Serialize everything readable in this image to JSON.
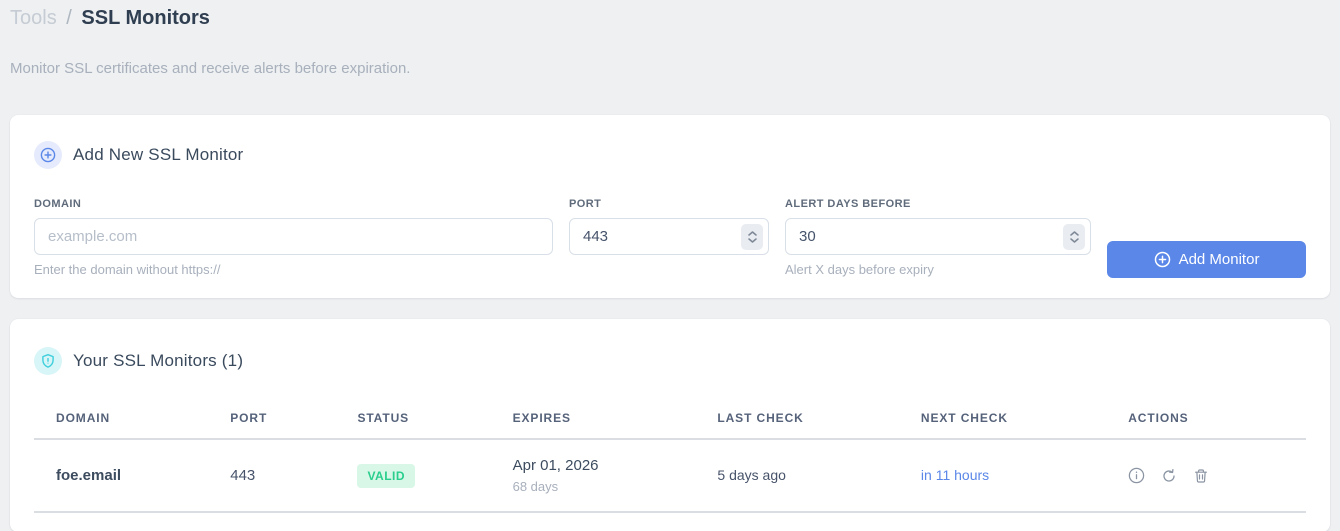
{
  "breadcrumb": {
    "section": "Tools",
    "separator": "/",
    "current": "SSL Monitors"
  },
  "subtitle": "Monitor SSL certificates and receive alerts before expiration.",
  "add_form": {
    "title": "Add New SSL Monitor",
    "fields": {
      "domain": {
        "label": "DOMAIN",
        "placeholder": "example.com",
        "helper": "Enter the domain without https://"
      },
      "port": {
        "label": "PORT",
        "value": "443"
      },
      "alert_days": {
        "label": "ALERT DAYS BEFORE",
        "value": "30",
        "helper": "Alert X days before expiry"
      }
    },
    "submit_label": "Add Monitor"
  },
  "monitors": {
    "title": "Your SSL Monitors (1)",
    "count": "1",
    "table": {
      "headers": [
        "DOMAIN",
        "PORT",
        "STATUS",
        "EXPIRES",
        "LAST CHECK",
        "NEXT CHECK",
        "ACTIONS"
      ],
      "rows": [
        {
          "domain": "foe.email",
          "port": "443",
          "status": "VALID",
          "expires_date": "Apr 01, 2026",
          "expires_in": "68 days",
          "last_check": "5 days ago",
          "next_check": "in 11 hours"
        }
      ]
    }
  },
  "icons": {
    "header_add": "plus-circle-icon",
    "header_list": "shield-icon",
    "button": "plus-circle-icon",
    "row_actions": [
      "info-icon",
      "refresh-icon",
      "trash-icon"
    ]
  },
  "colors": {
    "accent_blue": "#5b87e8",
    "valid_badge_bg": "#d8f7e7",
    "valid_badge_text": "#29ce8d",
    "shield_cyan": "#3ecfdc",
    "page_bg": "#eef0f2",
    "heading_dark": "#2f3e50",
    "muted_text": "#a8b0bc"
  }
}
